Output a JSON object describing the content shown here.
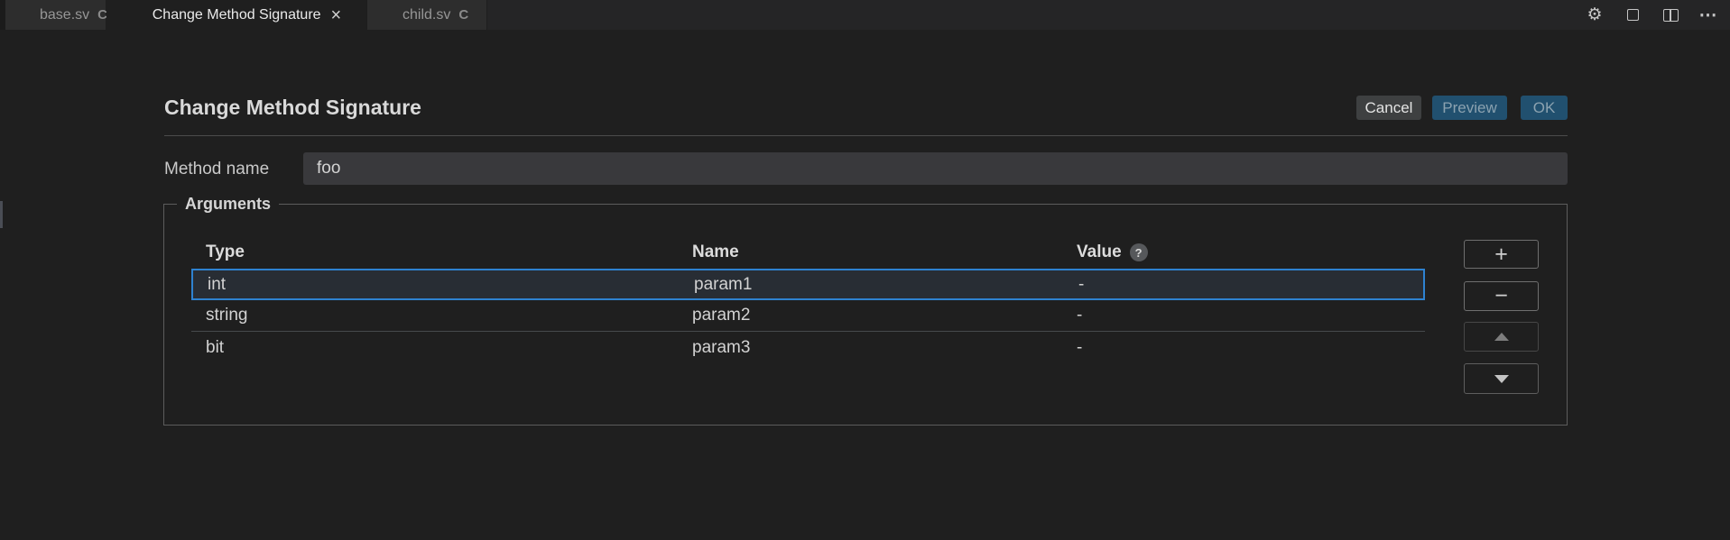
{
  "tabs": [
    {
      "label": "base.sv",
      "badge": "C",
      "active": false
    },
    {
      "label": "Change Method Signature",
      "close": "×",
      "active": true
    },
    {
      "label": "child.sv",
      "badge": "C",
      "active": false
    }
  ],
  "window_controls": {
    "settings_glyph": "⚙",
    "more_glyph": "⋯"
  },
  "dialog": {
    "title": "Change Method Signature",
    "actions": {
      "cancel": "Cancel",
      "preview": "Preview",
      "ok": "OK"
    },
    "method_name": {
      "label": "Method name",
      "value": "foo"
    },
    "arguments": {
      "legend": "Arguments",
      "columns": [
        "Type",
        "Name",
        "Value"
      ],
      "help_badge": "?",
      "rows": [
        {
          "type": "int",
          "name": "param1",
          "value": "-",
          "selected": true
        },
        {
          "type": "string",
          "name": "param2",
          "value": "-",
          "selected": false
        },
        {
          "type": "bit",
          "name": "param3",
          "value": "-",
          "selected": false
        }
      ],
      "row_buttons": {
        "add": "+",
        "remove": "−"
      }
    }
  },
  "colors": {
    "background": "#1f1f1f",
    "tab_strip": "#252526",
    "inactive_tab": "#2d2d2d",
    "selection_border": "#2e82d0",
    "selected_row_bg": "#282d34",
    "primary_button_bg": "#21506f",
    "cancel_button_bg": "#3e4041",
    "input_bg": "#39393c",
    "fieldset_border": "#5c5c5c"
  }
}
